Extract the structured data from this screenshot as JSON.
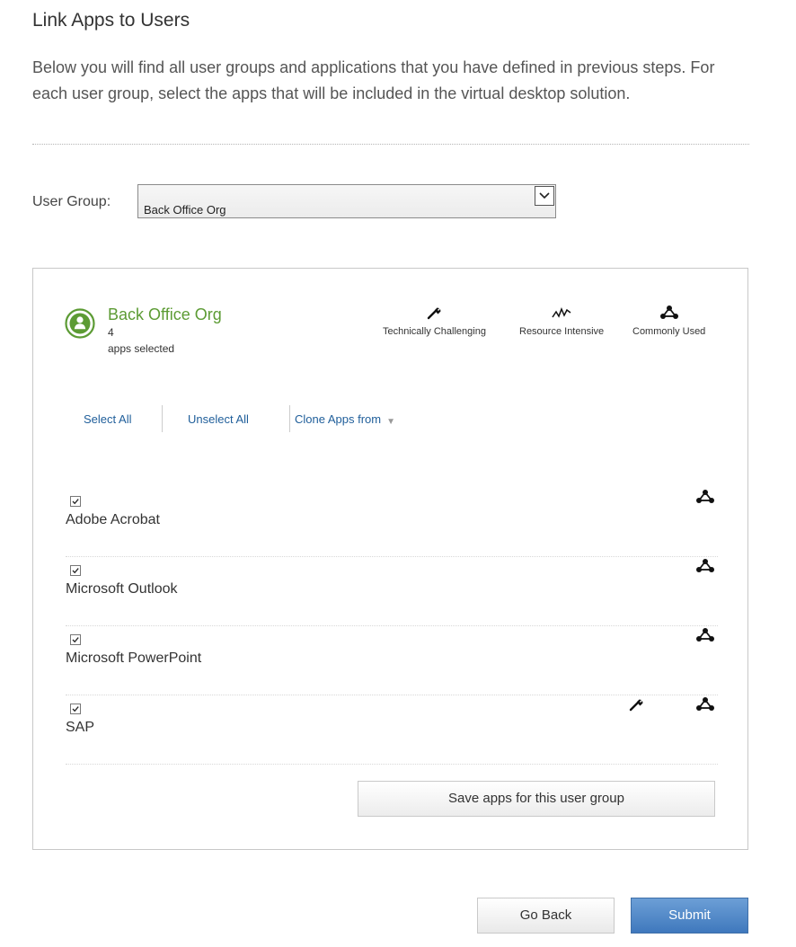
{
  "page": {
    "title": "Link Apps to Users",
    "intro": "Below you will find all user groups and applications that you have defined in previous steps. For each user group, select the apps that will be included in the virtual desktop solution."
  },
  "user_group": {
    "label": "User Group:",
    "selected": "Back Office Org"
  },
  "panel": {
    "group_name": "Back Office Org",
    "apps_selected_count": "4",
    "apps_selected_label": "apps selected",
    "legend": [
      {
        "label": "Technically Challenging",
        "icon": "wrench-icon"
      },
      {
        "label": "Resource Intensive",
        "icon": "activity-icon"
      },
      {
        "label": "Commonly Used",
        "icon": "network-icon"
      }
    ],
    "actions": {
      "select_all": "Select All",
      "unselect_all": "Unselect All",
      "clone_from": "Clone Apps from",
      "clone_caret": "▼"
    },
    "apps": [
      {
        "name": "Adobe Acrobat",
        "checked": true,
        "technically_challenging": false,
        "commonly_used": true
      },
      {
        "name": "Microsoft Outlook",
        "checked": true,
        "technically_challenging": false,
        "commonly_used": true
      },
      {
        "name": "Microsoft PowerPoint",
        "checked": true,
        "technically_challenging": false,
        "commonly_used": true
      },
      {
        "name": "SAP",
        "checked": true,
        "technically_challenging": true,
        "commonly_used": true
      }
    ],
    "save_button": "Save apps for this user group"
  },
  "footer": {
    "go_back": "Go Back",
    "submit": "Submit"
  },
  "colors": {
    "group_green": "#5c9b34",
    "link_blue": "#1f5e9a",
    "submit_blue": "#3f78bd"
  }
}
